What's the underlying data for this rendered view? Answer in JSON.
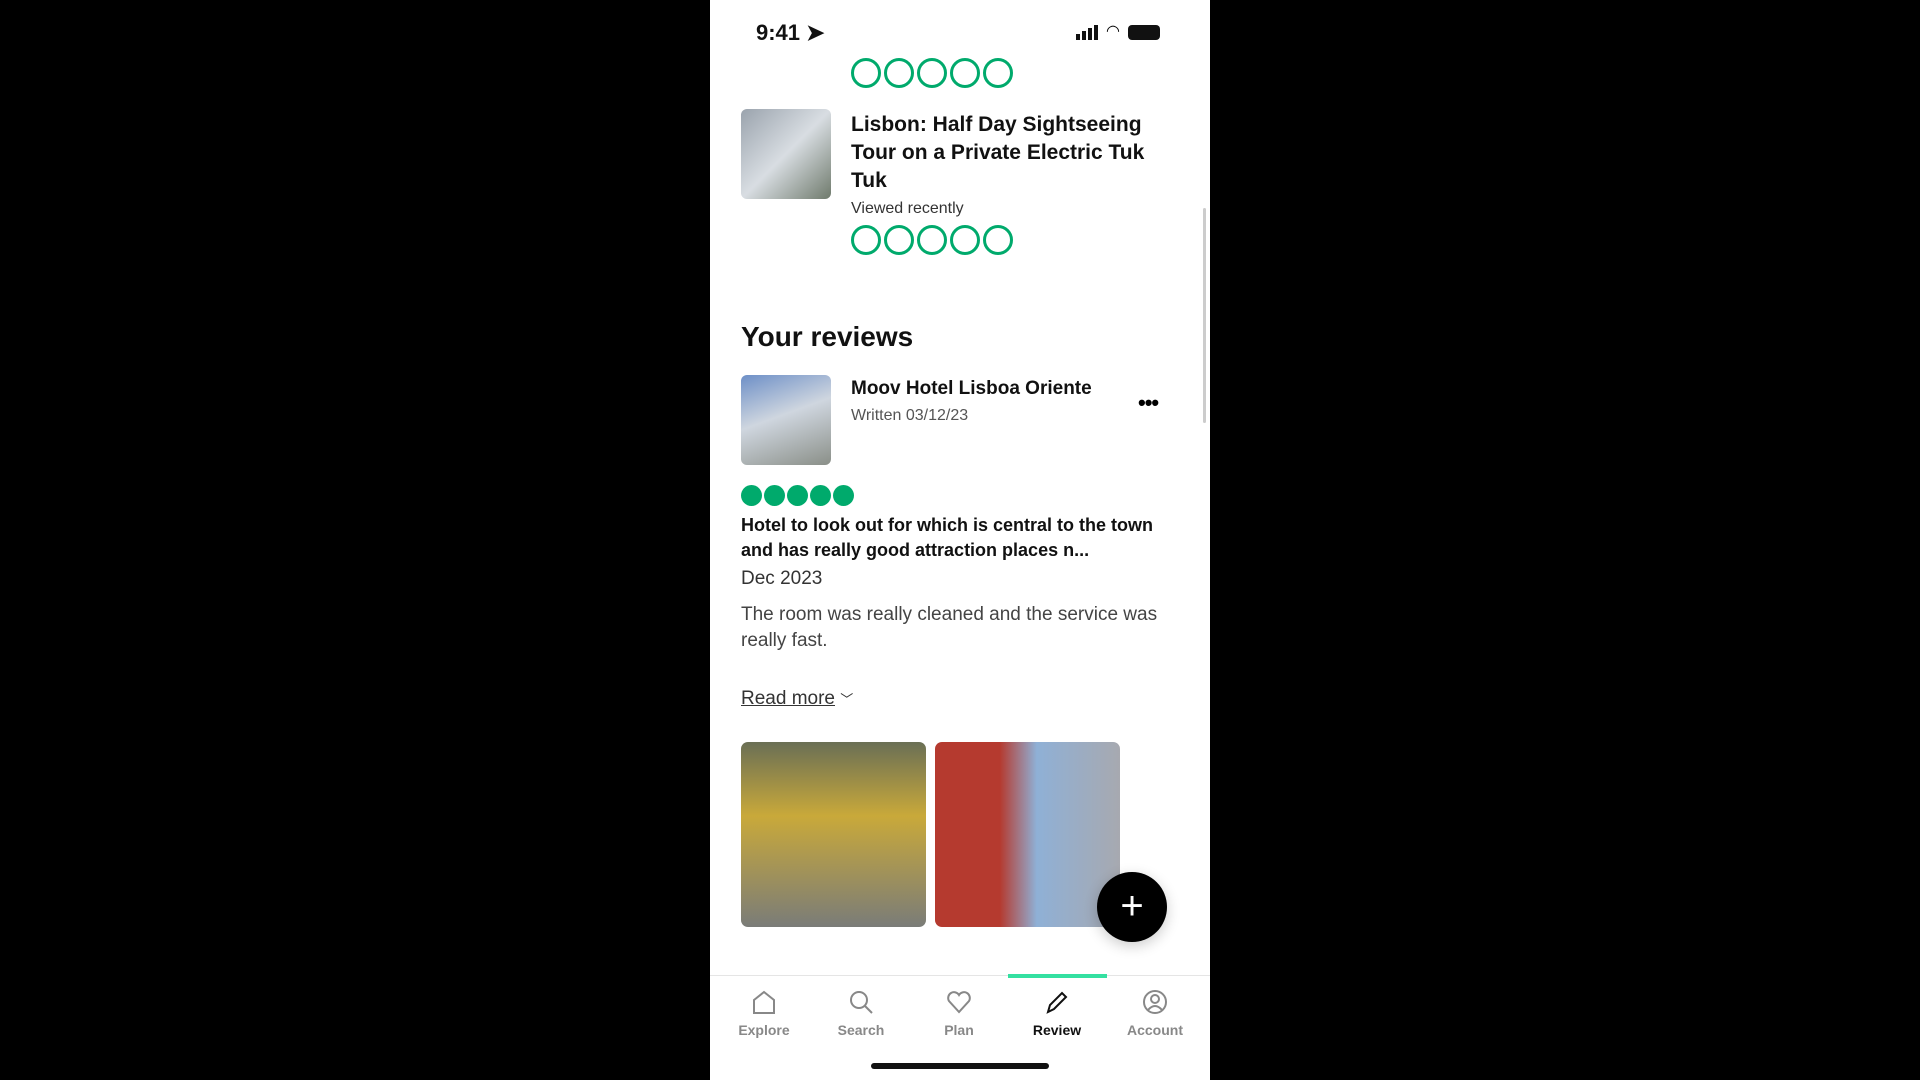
{
  "status_bar": {
    "time": "9:41"
  },
  "recent": {
    "title": "Lisbon: Half Day Sightseeing Tour on a Private Electric Tuk Tuk",
    "subtitle": "Viewed recently"
  },
  "reviews": {
    "heading": "Your reviews",
    "item": {
      "name": "Moov Hotel Lisboa Oriente",
      "written": "Written 03/12/23",
      "rating": 5,
      "headline": "Hotel to look out for which is central to the town and has really good attraction places n...",
      "date": "Dec 2023",
      "body": "The room was really cleaned and the service was really fast.",
      "read_more": "Read more"
    }
  },
  "nav": {
    "items": [
      {
        "label": "Explore",
        "icon": "home-icon"
      },
      {
        "label": "Search",
        "icon": "search-icon"
      },
      {
        "label": "Plan",
        "icon": "heart-icon"
      },
      {
        "label": "Review",
        "icon": "pencil-icon",
        "active": true
      },
      {
        "label": "Account",
        "icon": "account-icon"
      }
    ]
  },
  "colors": {
    "accent": "#00aa6c",
    "tab_indicator": "#34e0a1"
  }
}
